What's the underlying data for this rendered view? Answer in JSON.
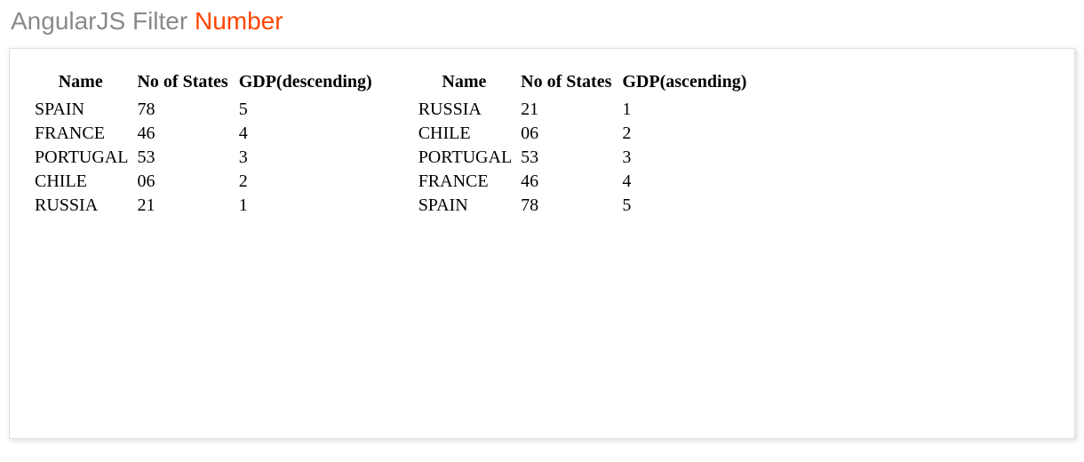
{
  "heading": {
    "prefix": "AngularJS Filter ",
    "highlight": "Number"
  },
  "headers": {
    "name": "Name",
    "states": "No of States",
    "gdp_desc": "GDP(descending)",
    "gdp_asc": "GDP(ascending)"
  },
  "left_rows": [
    {
      "name": "SPAIN",
      "states": "78",
      "gdp": "5"
    },
    {
      "name": "FRANCE",
      "states": "46",
      "gdp": "4"
    },
    {
      "name": "PORTUGAL",
      "states": "53",
      "gdp": "3"
    },
    {
      "name": "CHILE",
      "states": "06",
      "gdp": "2"
    },
    {
      "name": "RUSSIA",
      "states": "21",
      "gdp": "1"
    }
  ],
  "right_rows": [
    {
      "name": "RUSSIA",
      "states": "21",
      "gdp": "1"
    },
    {
      "name": "CHILE",
      "states": "06",
      "gdp": "2"
    },
    {
      "name": "PORTUGAL",
      "states": "53",
      "gdp": "3"
    },
    {
      "name": "FRANCE",
      "states": "46",
      "gdp": "4"
    },
    {
      "name": "SPAIN",
      "states": "78",
      "gdp": "5"
    }
  ]
}
